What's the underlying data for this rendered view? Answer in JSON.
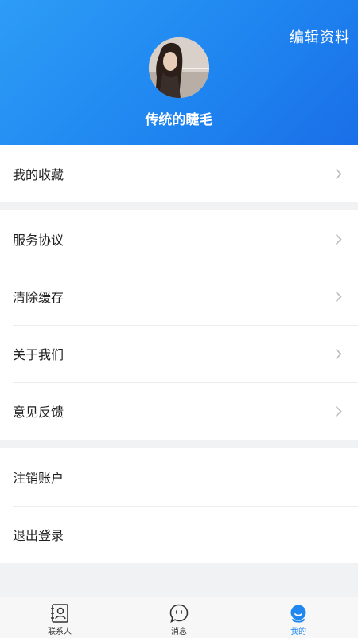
{
  "header": {
    "edit_profile_label": "编辑资料",
    "username": "传统的睫毛"
  },
  "menu": {
    "group1": [
      {
        "label": "我的收藏"
      }
    ],
    "group2": [
      {
        "label": "服务协议"
      },
      {
        "label": "清除缓存"
      },
      {
        "label": "关于我们"
      },
      {
        "label": "意见反馈"
      }
    ],
    "group3": [
      {
        "label": "注销账户"
      },
      {
        "label": "退出登录"
      }
    ]
  },
  "tabbar": {
    "tabs": [
      {
        "label": "联系人",
        "icon": "contacts-icon",
        "active": false
      },
      {
        "label": "消息",
        "icon": "message-icon",
        "active": false
      },
      {
        "label": "我的",
        "icon": "profile-icon",
        "active": true
      }
    ]
  },
  "colors": {
    "header_gradient_start": "#2d9cf6",
    "header_gradient_end": "#1a6fe8",
    "active_tab": "#1e88f0",
    "page_background": "#f1f2f4"
  }
}
